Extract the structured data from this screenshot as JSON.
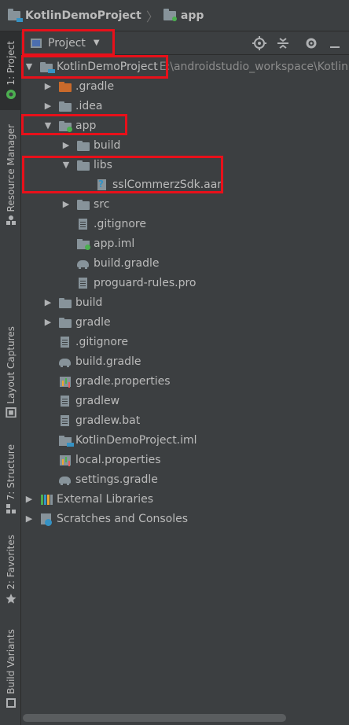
{
  "breadcrumb": {
    "project": "KotlinDemoProject",
    "module": "app"
  },
  "sidebar": {
    "tabs": [
      "1: Project",
      "Resource Manager",
      "Layout Captures",
      "7: Structure",
      "2: Favorites",
      "Build Variants"
    ]
  },
  "toolbar": {
    "view_label": "Project"
  },
  "tree": [
    {
      "label": "KotlinDemoProject",
      "path": "E:\\androidstudio_workspace\\Kotlin",
      "icon": "project-folder-icon"
    },
    {
      "label": ".gradle",
      "icon": "folder-orange-icon"
    },
    {
      "label": ".idea",
      "icon": "folder-icon"
    },
    {
      "label": "app",
      "icon": "module-folder-icon"
    },
    {
      "label": "build",
      "icon": "folder-icon"
    },
    {
      "label": "libs",
      "icon": "folder-icon"
    },
    {
      "label": "sslCommerzSdk.aar",
      "icon": "unknown-file-icon"
    },
    {
      "label": "src",
      "icon": "folder-icon"
    },
    {
      "label": ".gitignore",
      "icon": "file-icon"
    },
    {
      "label": "app.iml",
      "icon": "iml-file-icon"
    },
    {
      "label": "build.gradle",
      "icon": "gradle-icon"
    },
    {
      "label": "proguard-rules.pro",
      "icon": "file-icon"
    },
    {
      "label": "build",
      "icon": "folder-icon"
    },
    {
      "label": "gradle",
      "icon": "folder-icon"
    },
    {
      "label": ".gitignore",
      "icon": "file-icon"
    },
    {
      "label": "build.gradle",
      "icon": "gradle-icon"
    },
    {
      "label": "gradle.properties",
      "icon": "properties-icon"
    },
    {
      "label": "gradlew",
      "icon": "file-icon"
    },
    {
      "label": "gradlew.bat",
      "icon": "file-icon"
    },
    {
      "label": "KotlinDemoProject.iml",
      "icon": "iml-file-icon"
    },
    {
      "label": "local.properties",
      "icon": "properties-icon"
    },
    {
      "label": "settings.gradle",
      "icon": "gradle-icon"
    },
    {
      "label": "External Libraries",
      "icon": "libraries-icon"
    },
    {
      "label": "Scratches and Consoles",
      "icon": "scratches-icon"
    }
  ],
  "colors": {
    "highlight": "#e8101a",
    "background": "#3c3f41",
    "text": "#bbbbbb"
  }
}
